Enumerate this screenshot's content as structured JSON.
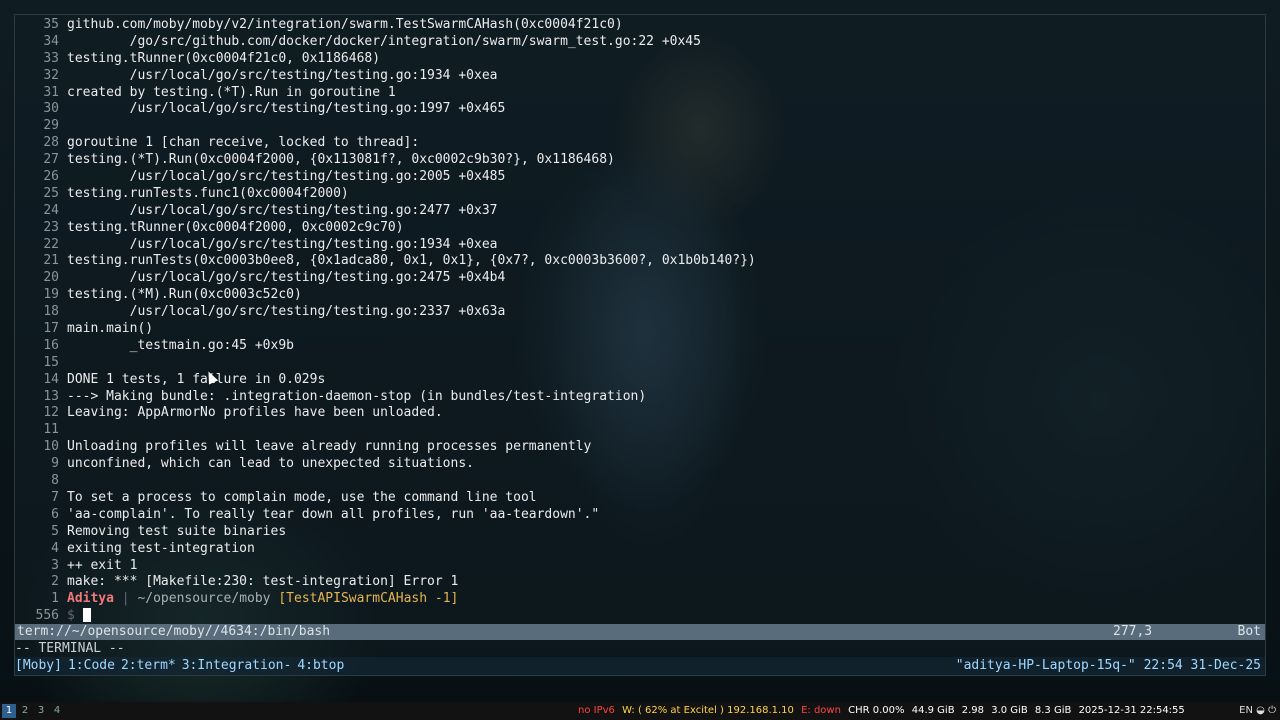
{
  "lines": [
    {
      "n": "35",
      "t": "github.com/moby/moby/v2/integration/swarm.TestSwarmCAHash(0xc0004f21c0)"
    },
    {
      "n": "34",
      "t": "        /go/src/github.com/docker/docker/integration/swarm/swarm_test.go:22 +0x45"
    },
    {
      "n": "33",
      "t": "testing.tRunner(0xc0004f21c0, 0x1186468)"
    },
    {
      "n": "32",
      "t": "        /usr/local/go/src/testing/testing.go:1934 +0xea"
    },
    {
      "n": "31",
      "t": "created by testing.(*T).Run in goroutine 1"
    },
    {
      "n": "30",
      "t": "        /usr/local/go/src/testing/testing.go:1997 +0x465"
    },
    {
      "n": "29",
      "t": ""
    },
    {
      "n": "28",
      "t": "goroutine 1 [chan receive, locked to thread]:"
    },
    {
      "n": "27",
      "t": "testing.(*T).Run(0xc0004f2000, {0x113081f?, 0xc0002c9b30?}, 0x1186468)"
    },
    {
      "n": "26",
      "t": "        /usr/local/go/src/testing/testing.go:2005 +0x485"
    },
    {
      "n": "25",
      "t": "testing.runTests.func1(0xc0004f2000)"
    },
    {
      "n": "24",
      "t": "        /usr/local/go/src/testing/testing.go:2477 +0x37"
    },
    {
      "n": "23",
      "t": "testing.tRunner(0xc0004f2000, 0xc0002c9c70)"
    },
    {
      "n": "22",
      "t": "        /usr/local/go/src/testing/testing.go:1934 +0xea"
    },
    {
      "n": "21",
      "t": "testing.runTests(0xc0003b0ee8, {0x1adca80, 0x1, 0x1}, {0x7?, 0xc0003b3600?, 0x1b0b140?})"
    },
    {
      "n": "20",
      "t": "        /usr/local/go/src/testing/testing.go:2475 +0x4b4"
    },
    {
      "n": "19",
      "t": "testing.(*M).Run(0xc0003c52c0)"
    },
    {
      "n": "18",
      "t": "        /usr/local/go/src/testing/testing.go:2337 +0x63a"
    },
    {
      "n": "17",
      "t": "main.main()"
    },
    {
      "n": "16",
      "t": "        _testmain.go:45 +0x9b"
    },
    {
      "n": "15",
      "t": ""
    },
    {
      "n": "14",
      "t": "DONE 1 tests, 1 failure in 0.029s"
    },
    {
      "n": "13",
      "t": "---> Making bundle: .integration-daemon-stop (in bundles/test-integration)"
    },
    {
      "n": "12",
      "t": "Leaving: AppArmorNo profiles have been unloaded."
    },
    {
      "n": "11",
      "t": ""
    },
    {
      "n": "10",
      "t": "Unloading profiles will leave already running processes permanently"
    },
    {
      "n": "9",
      "t": "unconfined, which can lead to unexpected situations."
    },
    {
      "n": "8",
      "t": ""
    },
    {
      "n": "7",
      "t": "To set a process to complain mode, use the command line tool"
    },
    {
      "n": "6",
      "t": "'aa-complain'. To really tear down all profiles, run 'aa-teardown'.\""
    },
    {
      "n": "5",
      "t": "Removing test suite binaries"
    },
    {
      "n": "4",
      "t": "exiting test-integration"
    },
    {
      "n": "3",
      "t": "++ exit 1"
    },
    {
      "n": "2",
      "t": "make: *** [Makefile:230: test-integration] Error 1"
    }
  ],
  "prompt": {
    "n": "1",
    "user": "Aditya",
    "sep": " | ",
    "path": "~/opensource/moby",
    "branch": "[TestAPISwarmCAHash -1]"
  },
  "input_line": {
    "n": "556",
    "dollar": "$"
  },
  "statusline": {
    "buffer": "term://~/opensource/moby//4634:/bin/bash",
    "position": "277,3",
    "scroll": "Bot"
  },
  "mode": "-- TERMINAL --",
  "tmux": {
    "session": "[Moby]",
    "windows": [
      "1:Code",
      "2:term*",
      "3:Integration-",
      "4:btop"
    ],
    "right": "\"aditya-HP-Laptop-15q-\" 22:54 31-Dec-25"
  },
  "panel": {
    "workspaces": [
      "1",
      "2",
      "3",
      "4"
    ],
    "ipv6": "no IPv6",
    "wifi": "W: ( 62% at Excitel ) 192.168.1.10",
    "eth": "E: down",
    "chr": "CHR 0.00%",
    "disk": "44.9 GiB",
    "load": "2.98",
    "mem": "3.0 GiB",
    "swap": "8.3 GiB",
    "datetime": "2025-12-31 22:54:55",
    "lang": "EN"
  }
}
